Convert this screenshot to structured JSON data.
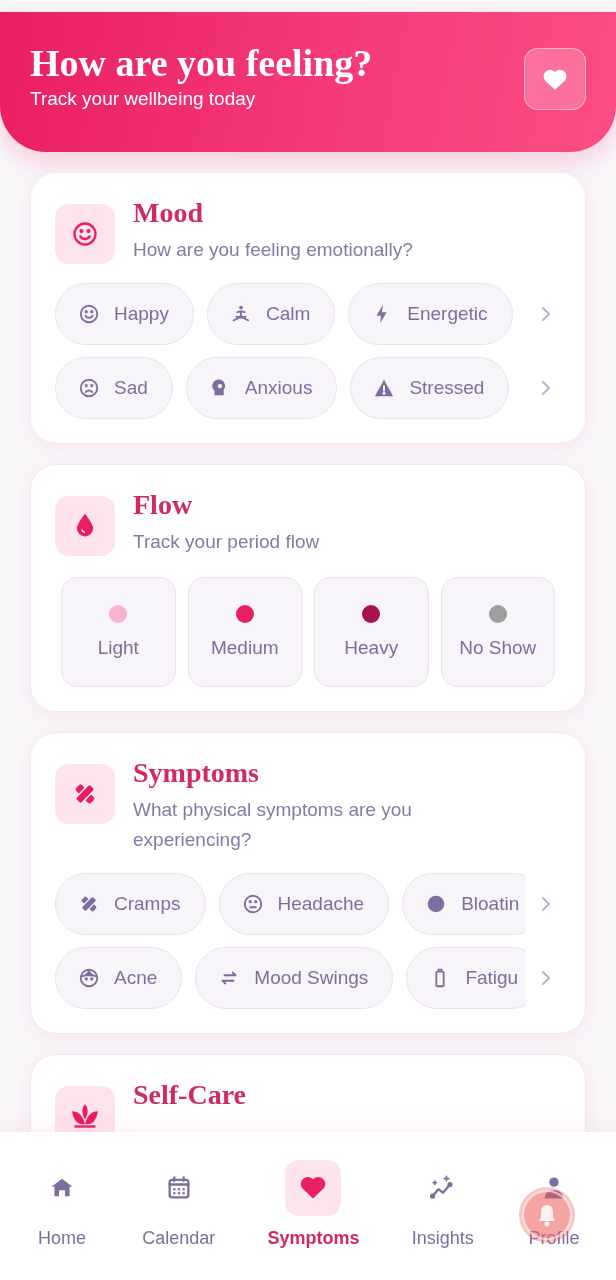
{
  "header": {
    "title": "How are you feeling?",
    "subtitle": "Track your wellbeing today"
  },
  "sections": [
    {
      "kind": "chips",
      "title": "Mood",
      "subtitle": "How are you feeling emotionally?",
      "chip_rows": [
        [
          {
            "label": "Happy"
          },
          {
            "label": "Calm"
          },
          {
            "label": "Energetic"
          }
        ],
        [
          {
            "label": "Sad"
          },
          {
            "label": "Anxious"
          },
          {
            "label": "Stressed"
          }
        ]
      ]
    },
    {
      "kind": "flow",
      "title": "Flow",
      "subtitle": "Track your period flow",
      "options": [
        {
          "label": "Light",
          "color": "#f8b4cf"
        },
        {
          "label": "Medium",
          "color": "#e91e63"
        },
        {
          "label": "Heavy",
          "color": "#a8124f"
        },
        {
          "label": "No Show",
          "color": "#9e9e9e"
        }
      ]
    },
    {
      "kind": "chips",
      "title": "Symptoms",
      "subtitle": "What physical symptoms are you experiencing?",
      "chip_rows": [
        [
          {
            "label": "Cramps"
          },
          {
            "label": "Headache"
          },
          {
            "label": "Bloatin"
          }
        ],
        [
          {
            "label": "Acne"
          },
          {
            "label": "Mood Swings"
          },
          {
            "label": "Fatigu"
          }
        ]
      ]
    },
    {
      "kind": "chips",
      "title": "Self-Care"
    }
  ],
  "nav": [
    {
      "label": "Home",
      "selected": false
    },
    {
      "label": "Calendar",
      "selected": false
    },
    {
      "label": "Symptoms",
      "selected": true
    },
    {
      "label": "Insights",
      "selected": false
    },
    {
      "label": "Profile",
      "selected": false
    }
  ]
}
